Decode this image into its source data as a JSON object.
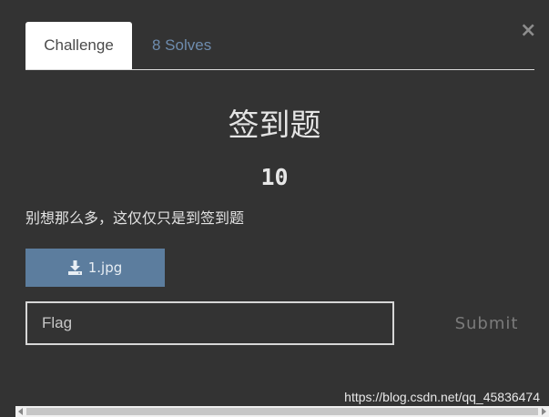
{
  "tabs": [
    {
      "label": "Challenge",
      "active": true
    },
    {
      "label": "8 Solves",
      "active": false
    }
  ],
  "close_symbol": "×",
  "challenge": {
    "title": "签到题",
    "points": "10",
    "description": "别想那么多，这仅仅只是到签到题"
  },
  "file": {
    "label": "1.jpg",
    "icon": "download-icon"
  },
  "flag_input": {
    "placeholder": "Flag",
    "value": ""
  },
  "submit_label": "Submit",
  "watermark": "https://blog.csdn.net/qq_45836474",
  "colors": {
    "background": "#333333",
    "tab_active_bg": "#ffffff",
    "tab_inactive_text": "#6e8cae",
    "file_button_bg": "#5c7d9e",
    "submit_text": "#7b7b7b"
  }
}
